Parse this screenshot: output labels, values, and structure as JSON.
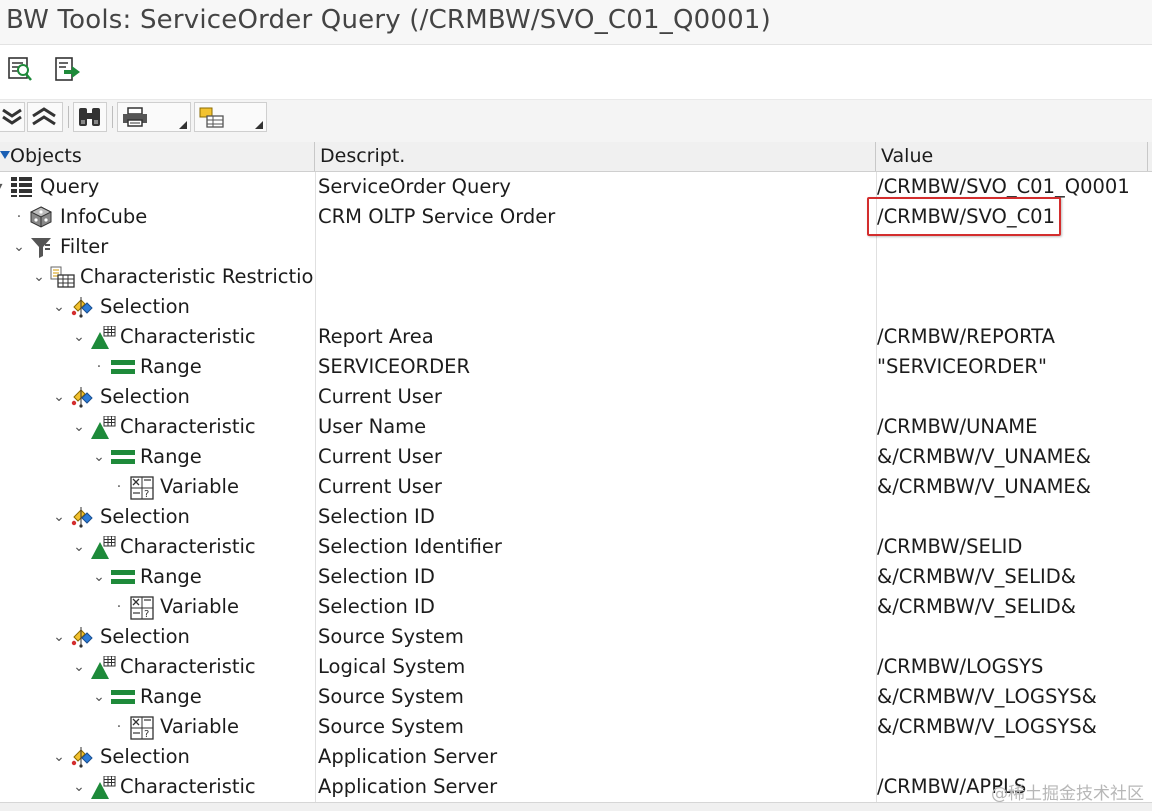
{
  "window": {
    "title": "BW Tools: ServiceOrder Query (/CRMBW/SVO_C01_Q0001)"
  },
  "appbar": {
    "buttons": [
      {
        "icon": "search-list-icon"
      },
      {
        "icon": "export-icon"
      }
    ]
  },
  "toolbar": {
    "buttons": [
      {
        "icon": "expand-all-icon"
      },
      {
        "icon": "collapse-all-icon"
      },
      {
        "icon": "find-icon"
      },
      {
        "icon": "print-icon"
      },
      {
        "icon": "layout-icon"
      }
    ]
  },
  "grid": {
    "columns": [
      "Objects",
      "Descript.",
      "Value"
    ],
    "rows": [
      {
        "toggle": "▾",
        "icon": "query",
        "label": "Query",
        "desc": "ServiceOrder Query",
        "value": "/CRMBW/SVO_C01_Q0001"
      },
      {
        "toggle": "·",
        "icon": "infocube",
        "label": "InfoCube",
        "desc": "CRM OLTP Service Order",
        "value": "/CRMBW/SVO_C01"
      },
      {
        "toggle": "⌄",
        "icon": "filter",
        "label": "Filter",
        "desc": "",
        "value": ""
      },
      {
        "toggle": "⌄",
        "icon": "restrictions",
        "label": "Characteristic Restrictions",
        "desc": "",
        "value": ""
      },
      {
        "toggle": "⌄",
        "icon": "selection",
        "label": "Selection",
        "desc": "",
        "value": ""
      },
      {
        "toggle": "⌄",
        "icon": "characteristic",
        "label": "Characteristic",
        "desc": "Report Area",
        "value": "/CRMBW/REPORTA"
      },
      {
        "toggle": "·",
        "icon": "range",
        "label": "Range",
        "desc": "SERVICEORDER",
        "value": "\"SERVICEORDER\""
      },
      {
        "toggle": "⌄",
        "icon": "selection",
        "label": "Selection",
        "desc": "Current User",
        "value": ""
      },
      {
        "toggle": "⌄",
        "icon": "characteristic",
        "label": "Characteristic",
        "desc": "User Name",
        "value": "/CRMBW/UNAME"
      },
      {
        "toggle": "⌄",
        "icon": "range",
        "label": "Range",
        "desc": "Current User",
        "value": "&/CRMBW/V_UNAME&"
      },
      {
        "toggle": "·",
        "icon": "variable",
        "label": "Variable",
        "desc": "Current User",
        "value": "&/CRMBW/V_UNAME&"
      },
      {
        "toggle": "⌄",
        "icon": "selection",
        "label": "Selection",
        "desc": "Selection ID",
        "value": ""
      },
      {
        "toggle": "⌄",
        "icon": "characteristic",
        "label": "Characteristic",
        "desc": "Selection Identifier",
        "value": "/CRMBW/SELID"
      },
      {
        "toggle": "⌄",
        "icon": "range",
        "label": "Range",
        "desc": "Selection ID",
        "value": "&/CRMBW/V_SELID&"
      },
      {
        "toggle": "·",
        "icon": "variable",
        "label": "Variable",
        "desc": "Selection ID",
        "value": "&/CRMBW/V_SELID&"
      },
      {
        "toggle": "⌄",
        "icon": "selection",
        "label": "Selection",
        "desc": "Source System",
        "value": ""
      },
      {
        "toggle": "⌄",
        "icon": "characteristic",
        "label": "Characteristic",
        "desc": "Logical System",
        "value": "/CRMBW/LOGSYS"
      },
      {
        "toggle": "⌄",
        "icon": "range",
        "label": "Range",
        "desc": "Source System",
        "value": "&/CRMBW/V_LOGSYS&"
      },
      {
        "toggle": "·",
        "icon": "variable",
        "label": "Variable",
        "desc": "Source System",
        "value": "&/CRMBW/V_LOGSYS&"
      },
      {
        "toggle": "⌄",
        "icon": "selection",
        "label": "Selection",
        "desc": "Application Server",
        "value": ""
      },
      {
        "toggle": "⌄",
        "icon": "characteristic",
        "label": "Characteristic",
        "desc": "Application Server",
        "value": "/CRMBW/APPLS"
      }
    ]
  },
  "watermark": "@稀土掘金技术社区",
  "colors": {
    "highlight": "#d32d2d",
    "green": "#1e8a3a",
    "header_bg": "#f0f0f0"
  }
}
